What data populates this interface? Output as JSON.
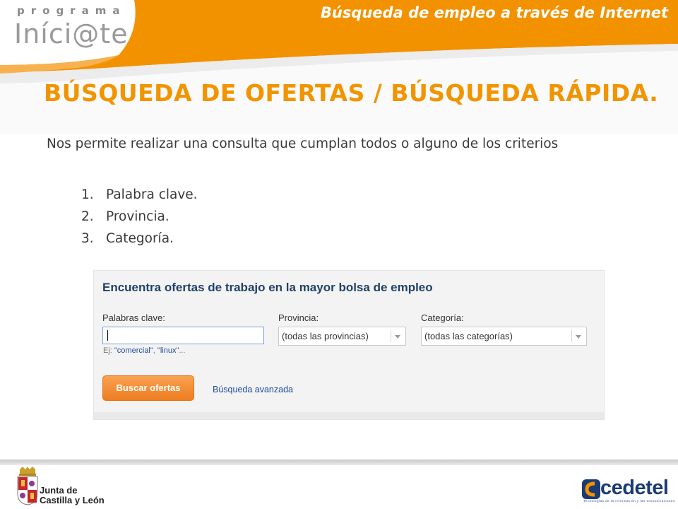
{
  "header": {
    "program_label": "programa",
    "program_name": "Iníci@te",
    "document_title": "Búsqueda de empleo a través de Internet"
  },
  "slide": {
    "title": "BÚSQUEDA DE OFERTAS / BÚSQUEDA RÁPIDA.",
    "intro": "Nos permite realizar una consulta que cumplan todos o alguno de los criterios",
    "criteria": [
      {
        "number": "1.",
        "label": "Palabra clave."
      },
      {
        "number": "2.",
        "label": "Provincia."
      },
      {
        "number": "3.",
        "label": "Categoría."
      }
    ]
  },
  "search_widget": {
    "title": "Encuentra ofertas de trabajo en la mayor bolsa de empleo",
    "keywords_label": "Palabras clave:",
    "keywords_value": "",
    "hint_prefix": "Ej: ",
    "hint_example_1": "\"comercial\"",
    "hint_separator": ", ",
    "hint_example_2": "\"linux\"",
    "hint_suffix": "...",
    "province_label": "Provincia:",
    "province_selected": "(todas las provincias)",
    "category_label": "Categoría:",
    "category_selected": "(todas las categorías)",
    "search_button": "Buscar ofertas",
    "advanced_link": "Búsqueda avanzada"
  },
  "footer": {
    "left_logo_line1": "Junta de",
    "left_logo_line2": "Castilla y León",
    "right_logo": "cedetel",
    "right_tagline": "Tecnologías de la Información y las Comunicaciones"
  },
  "colors": {
    "accent_orange": "#f29400",
    "banner_orange": "#f39200",
    "widget_title_blue": "#1f4168",
    "link_blue": "#1f4a9a"
  }
}
